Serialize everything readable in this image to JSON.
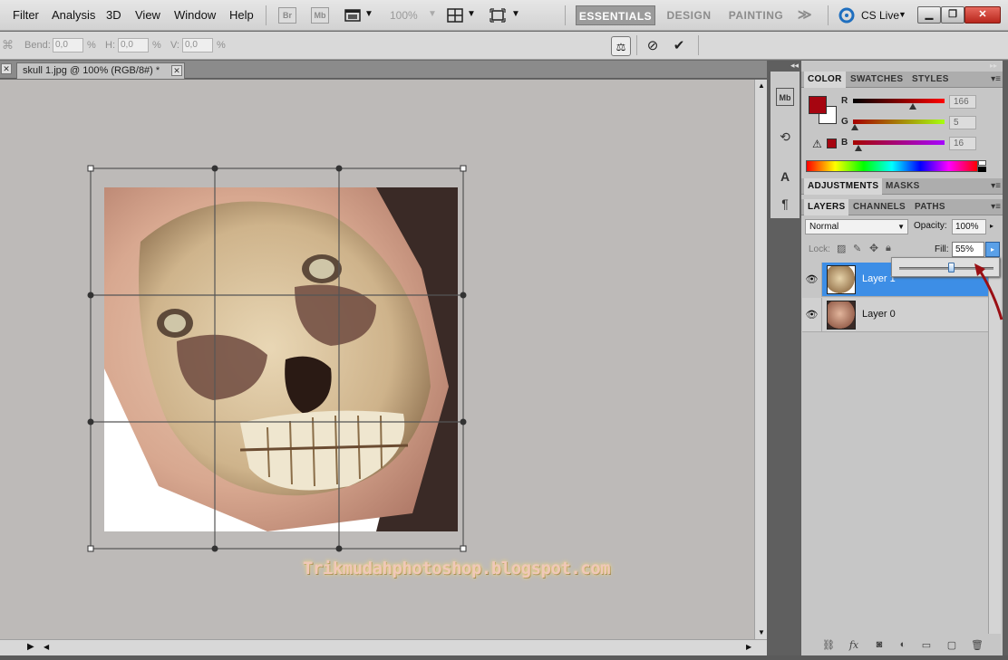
{
  "menu": {
    "items": [
      "Filter",
      "Analysis",
      "3D",
      "View",
      "Window",
      "Help"
    ],
    "bridge_label": "Br",
    "minibridge_label": "Mb",
    "zoom": "100%",
    "workspaces": [
      "ESSENTIALS",
      "DESIGN",
      "PAINTING"
    ],
    "more_label": "≫",
    "cslive": "CS Live"
  },
  "options": {
    "bend_label": "Bend:",
    "bend_value": "0,0",
    "h_label": "H:",
    "h_value": "0,0",
    "v_label": "V:",
    "v_value": "0,0",
    "percent": "%"
  },
  "document": {
    "tab_title": "skull 1.jpg @ 100% (RGB/8#) *",
    "close_glyph": "✕"
  },
  "watermark": "Trikmudahphotoshop.blogspot.com",
  "color_panel": {
    "tabs": [
      "COLOR",
      "SWATCHES",
      "STYLES"
    ],
    "r_label": "R",
    "g_label": "G",
    "b_label": "B",
    "r": 166,
    "g": 5,
    "b": 16,
    "r_text": "166",
    "g_text": "5",
    "b_text": "16",
    "foreground": "#a60510",
    "background": "#ffffff"
  },
  "adjustments_panel": {
    "tabs": [
      "ADJUSTMENTS",
      "MASKS"
    ]
  },
  "layers_panel": {
    "tabs": [
      "LAYERS",
      "CHANNELS",
      "PATHS"
    ],
    "blend_mode": "Normal",
    "opacity_label": "Opacity:",
    "opacity_value": "100%",
    "lock_label": "Lock:",
    "fill_label": "Fill:",
    "fill_value": "55%",
    "fill_fraction": 0.55,
    "layers": [
      {
        "name": "Layer 1",
        "selected": true
      },
      {
        "name": "Layer 0",
        "selected": false
      }
    ]
  },
  "colors": {
    "selection_blue": "#3d8ee6",
    "accent_red": "#a60510"
  }
}
